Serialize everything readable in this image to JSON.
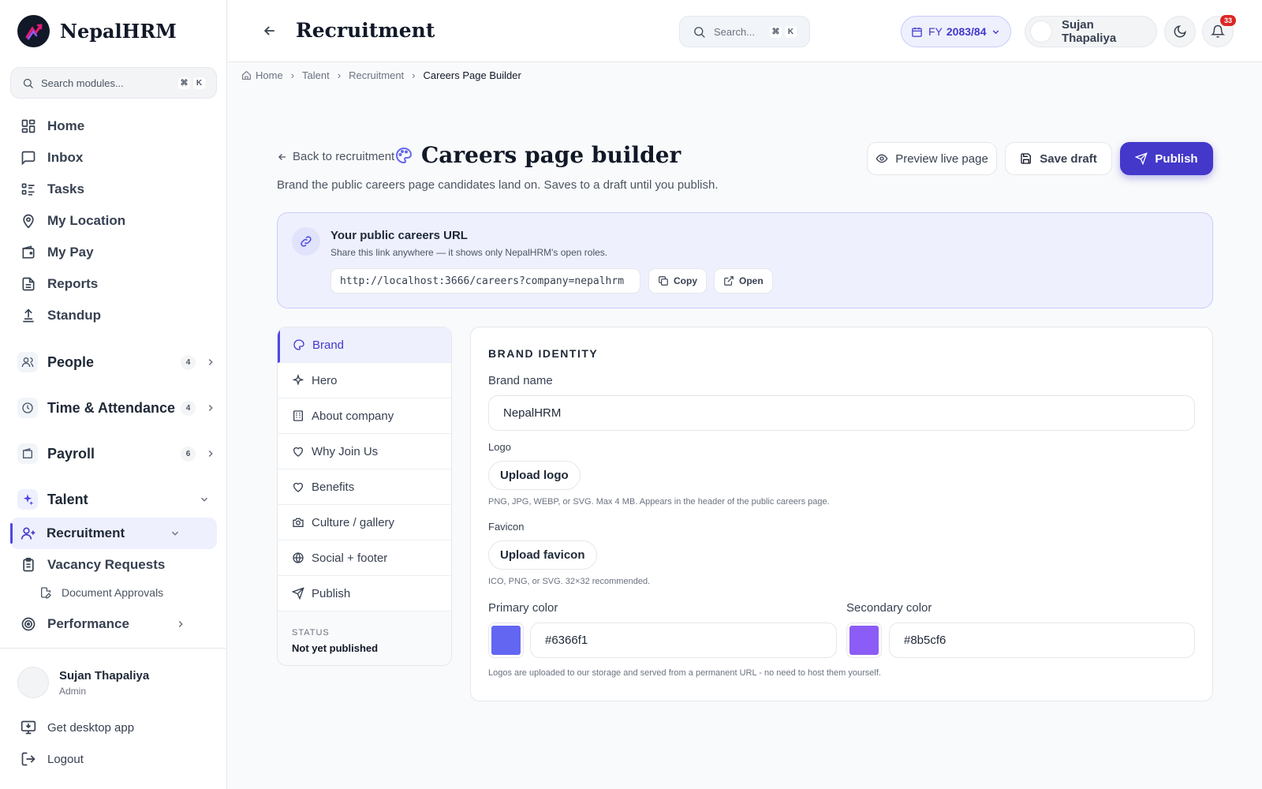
{
  "app": {
    "name": "NepalHRM"
  },
  "sidebar": {
    "search_placeholder": "Search modules...",
    "kbd": [
      "⌘",
      "K"
    ],
    "items": [
      {
        "label": "Home"
      },
      {
        "label": "Inbox"
      },
      {
        "label": "Tasks"
      },
      {
        "label": "My Location"
      },
      {
        "label": "My Pay"
      },
      {
        "label": "Reports"
      },
      {
        "label": "Standup"
      }
    ],
    "groups": [
      {
        "label": "People",
        "count": "4"
      },
      {
        "label": "Time & Attendance",
        "count": "4"
      },
      {
        "label": "Payroll",
        "count": "6"
      },
      {
        "label": "Talent"
      }
    ],
    "talent_children": [
      {
        "label": "Recruitment"
      },
      {
        "label": "Vacancy Requests"
      },
      {
        "label": "Document Approvals"
      }
    ],
    "performance": "Performance",
    "user": {
      "name": "Sujan Thapaliya",
      "role": "Admin"
    },
    "get_desktop": "Get desktop app",
    "logout": "Logout"
  },
  "header": {
    "title": "Recruitment",
    "search_placeholder": "Search...",
    "kbd": [
      "⌘",
      "K"
    ],
    "fy_prefix": "FY",
    "fy_value": "2083/84",
    "user_name": "Sujan Thapaliya",
    "notif_count": "33"
  },
  "breadcrumb": [
    "Home",
    "Talent",
    "Recruitment",
    "Careers Page Builder"
  ],
  "page": {
    "back_label": "Back to recruitment",
    "title": "Careers page builder",
    "subtitle": "Brand the public careers page candidates land on. Saves to a draft until you publish.",
    "preview_label": "Preview live page",
    "save_label": "Save draft",
    "publish_label": "Publish"
  },
  "url_card": {
    "title": "Your public careers URL",
    "desc": "Share this link anywhere — it shows only NepalHRM's open roles.",
    "url": "http://localhost:3666/careers?company=nepalhrm",
    "copy": "Copy",
    "open": "Open"
  },
  "tabs": [
    {
      "label": "Brand",
      "icon": "palette-icon"
    },
    {
      "label": "Hero",
      "icon": "sparkles-icon"
    },
    {
      "label": "About company",
      "icon": "building-icon"
    },
    {
      "label": "Why Join Us",
      "icon": "heart-icon"
    },
    {
      "label": "Benefits",
      "icon": "heart-icon"
    },
    {
      "label": "Culture / gallery",
      "icon": "camera-icon"
    },
    {
      "label": "Social + footer",
      "icon": "globe-icon"
    },
    {
      "label": "Publish",
      "icon": "send-icon"
    }
  ],
  "status": {
    "label": "STATUS",
    "value": "Not yet published"
  },
  "brand_form": {
    "section_title": "BRAND IDENTITY",
    "brand_name_label": "Brand name",
    "brand_name_value": "NepalHRM",
    "logo_label": "Logo",
    "logo_button": "Upload logo",
    "logo_hint": "PNG, JPG, WEBP, or SVG. Max 4 MB. Appears in the header of the public careers page.",
    "favicon_label": "Favicon",
    "favicon_button": "Upload favicon",
    "favicon_hint": "ICO, PNG, or SVG. 32×32 recommended.",
    "primary_label": "Primary color",
    "primary_value": "#6366f1",
    "secondary_label": "Secondary color",
    "secondary_value": "#8b5cf6",
    "footer_hint": "Logos are uploaded to our storage and served from a permanent URL - no need to host them yourself."
  },
  "colors": {
    "accent": "#4338ca",
    "primary_swatch": "#6366f1",
    "secondary_swatch": "#8b5cf6"
  }
}
